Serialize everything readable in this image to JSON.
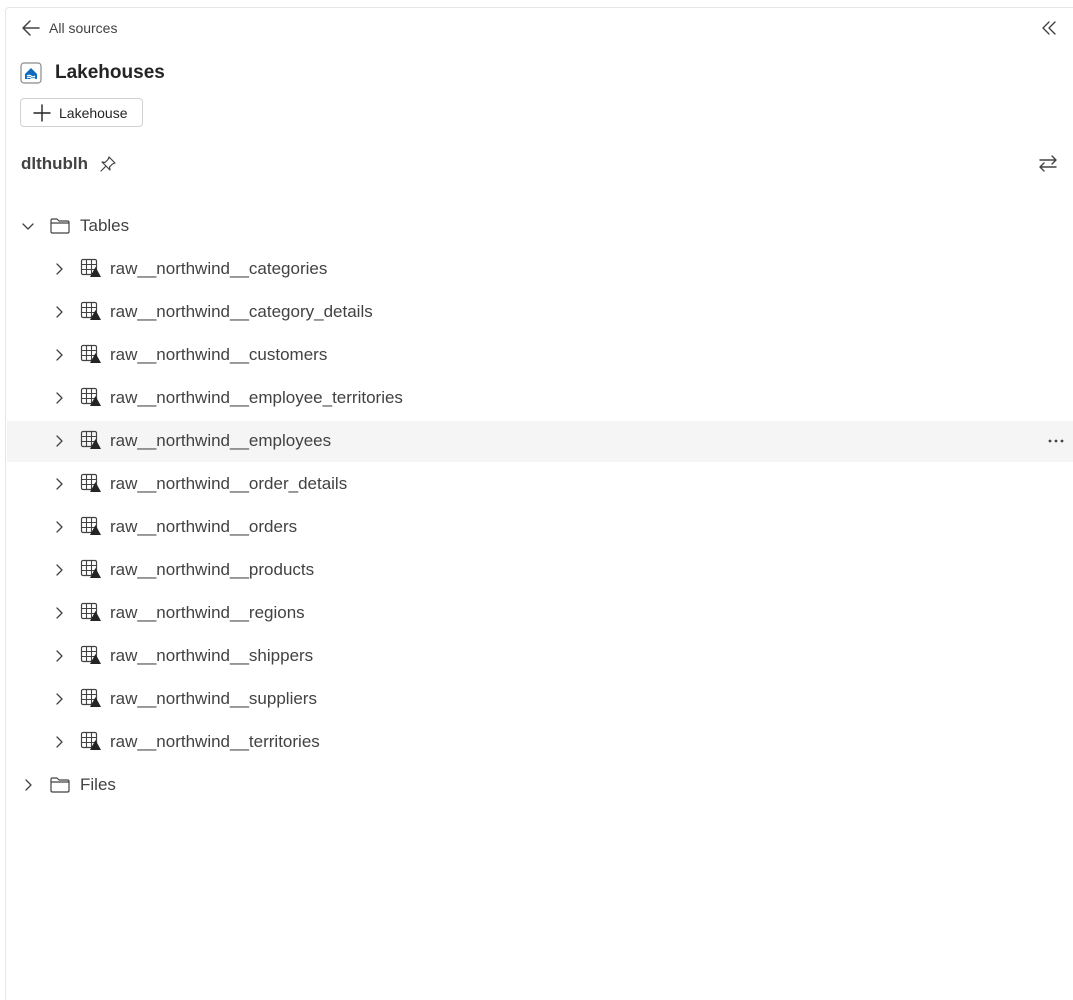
{
  "header": {
    "back_label": "All sources",
    "title": "Lakehouses",
    "add_button_label": "Lakehouse"
  },
  "lakehouse": {
    "name": "dlthublh"
  },
  "tree": {
    "tables_folder": "Tables",
    "files_folder": "Files",
    "tables": [
      "raw__northwind__categories",
      "raw__northwind__category_details",
      "raw__northwind__customers",
      "raw__northwind__employee_territories",
      "raw__northwind__employees",
      "raw__northwind__order_details",
      "raw__northwind__orders",
      "raw__northwind__products",
      "raw__northwind__regions",
      "raw__northwind__shippers",
      "raw__northwind__suppliers",
      "raw__northwind__territories"
    ],
    "hovered_table": "raw__northwind__employees",
    "more_label": "···"
  },
  "colors": {
    "accent": "#0f6cbd",
    "hover_row": "#f5f5f5",
    "text": "#424242"
  }
}
